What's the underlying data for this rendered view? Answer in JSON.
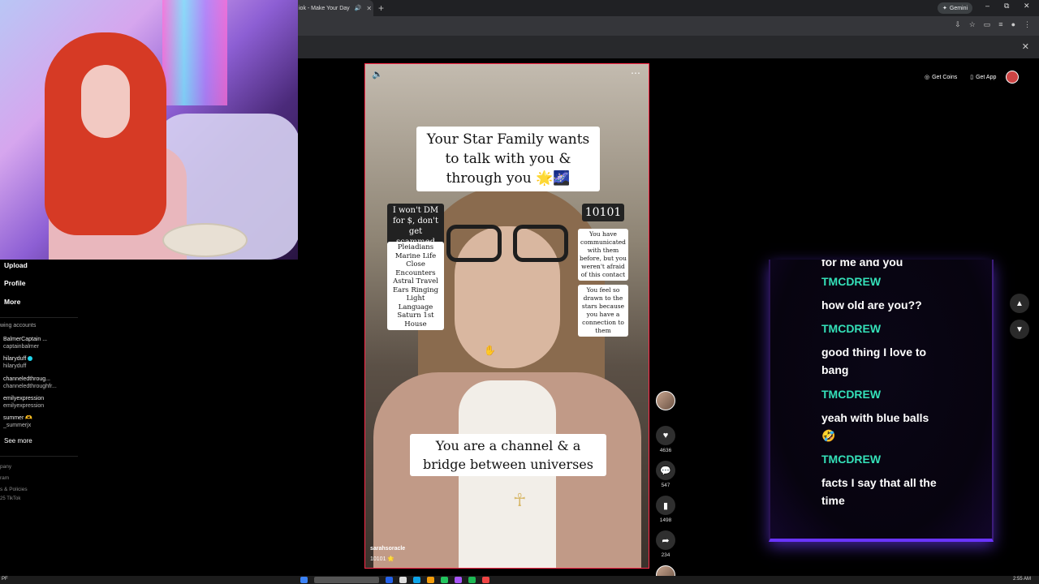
{
  "browser": {
    "tab_title": "iok - Make Your Day",
    "gemini_label": "Gemini",
    "window_controls": [
      "–",
      "⧉",
      "✕"
    ]
  },
  "app": {
    "get_coins": "Get Coins",
    "get_app": "Get App"
  },
  "sidebar": {
    "nav": [
      "Upload",
      "Profile",
      "More"
    ],
    "following_label": "wing accounts",
    "accounts": [
      {
        "name": "BalmerCaptain ...",
        "handle": "captainbalmer",
        "verified": false
      },
      {
        "name": "hilaryduff",
        "handle": "hilaryduff",
        "verified": true
      },
      {
        "name": "channeledthroug...",
        "handle": "channeledthroughfr...",
        "verified": false
      },
      {
        "name": "emilyexpression",
        "handle": "emilyexpression",
        "verified": false
      },
      {
        "name": "summer 🫶",
        "handle": "_summerjx",
        "verified": false
      }
    ],
    "see_more": "See more",
    "footer": [
      "pany",
      "ram",
      "s & Policies",
      "25 TikTok"
    ]
  },
  "video": {
    "title_caption": "Your Star Family wants to talk with you & through you 🌟🌌",
    "left_caption": "I won't DM for $, don't get scammed",
    "left_list": [
      "Pleiadians",
      "Marine Life",
      "Close Encounters",
      "Astral Travel",
      "Ears Ringing",
      "Light Language",
      "Saturn 1st House"
    ],
    "number_caption": "10101",
    "right_caption1": "You have communicated with them before, but you weren't afraid of this contact",
    "right_caption2": "You feel so drawn to the stars because you have a connection to them",
    "bottom_caption": "You are a channel & a bridge between universes",
    "author": "sarahsoracle",
    "description": "10101 🌟"
  },
  "actions": {
    "likes": "4636",
    "comments": "547",
    "saves": "1498",
    "shares": "234"
  },
  "chat": {
    "cut_line": "for me and you",
    "messages": [
      {
        "user": "TMCDREW",
        "text": "how old are you??"
      },
      {
        "user": "TMCDREW",
        "text": "good thing I love to bang"
      },
      {
        "user": "TMCDREW",
        "text": "yeah with blue balls 🤣"
      },
      {
        "user": "TMCDREW",
        "text": "facts I say that all the time"
      }
    ]
  },
  "taskbar": {
    "start_text": "PF",
    "clock": "2:55 AM"
  },
  "colors": {
    "accent": "#ff2b4a",
    "chat_name": "#34e0b8",
    "chat_glow": "#6a34ff"
  }
}
